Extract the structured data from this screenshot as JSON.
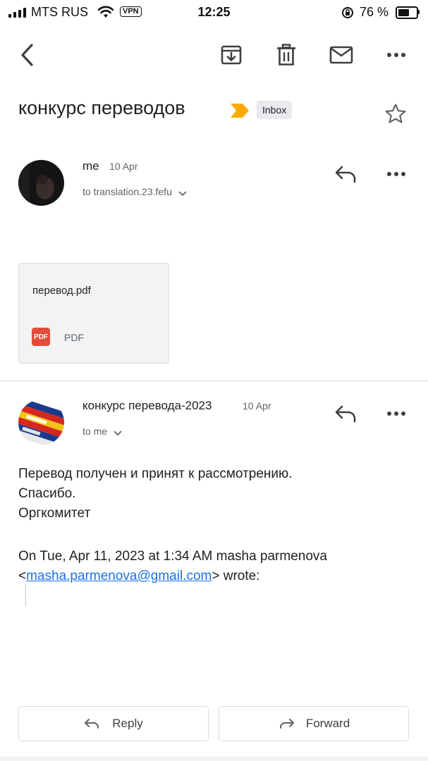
{
  "status_bar": {
    "carrier": "MTS RUS",
    "vpn": "VPN",
    "time": "12:25",
    "battery": "76 %",
    "battery_level": 0.76
  },
  "toolbar": {
    "icons": [
      "back-arrow-icon",
      "archive-icon",
      "delete-icon",
      "mark-unread-icon",
      "more-options-icon"
    ]
  },
  "thread": {
    "subject": "конкурс переводов",
    "label": "Inbox",
    "label_color": "#f9ab00"
  },
  "messages": [
    {
      "sender": "me",
      "date": "10 Apr",
      "recipients": "to translation.23.fefu",
      "attachment": {
        "name": "перевод.pdf",
        "badge": "PDF",
        "type": "PDF"
      }
    },
    {
      "sender": "конкурс перевода-2023",
      "date": "10 Apr",
      "recipients": "to me",
      "body": [
        "Перевод получен и принят к рассмотрению.",
        "Спасибо.",
        "Оргкомитет"
      ],
      "quote_prefix": "On Tue, Apr 11, 2023 at 1:34 AM masha parmenova",
      "quote_email": "masha.parmenova@gmail.com",
      "quote_suffix": "wrote:"
    }
  ],
  "actions": {
    "reply": "Reply",
    "forward": "Forward"
  }
}
